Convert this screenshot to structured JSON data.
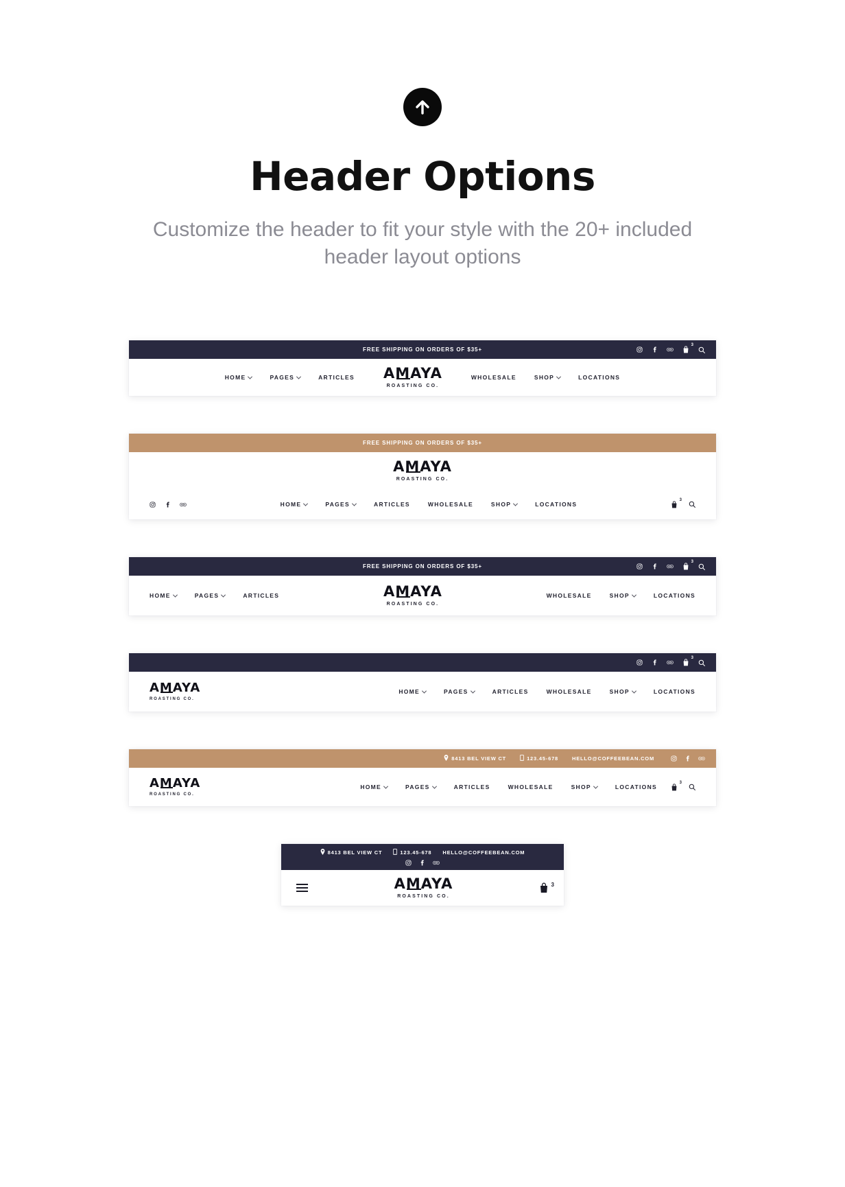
{
  "intro": {
    "icon": "arrow-up-circle-icon",
    "title": "Header Options",
    "subtitle": "Customize the header to fit your style with the 20+ included header layout options"
  },
  "brand": {
    "name": "AMAYA",
    "tagline": "ROASTING CO."
  },
  "colors": {
    "dark": "#292940",
    "tan": "#bf936c",
    "text": "#22222f",
    "muted": "#8b8b93"
  },
  "announcement": "FREE SHIPPING ON ORDERS OF $35+",
  "contact": {
    "address": "8413 BEL VIEW CT",
    "phone": "123.45-678",
    "email": "HELLO@COFFEEBEAN.COM"
  },
  "cart": {
    "count": "3"
  },
  "socials": [
    "instagram-icon",
    "facebook-icon",
    "tripadvisor-icon"
  ],
  "nav": {
    "home": "HOME",
    "pages": "PAGES",
    "articles": "ARTICLES",
    "wholesale": "WHOLESALE",
    "shop": "SHOP",
    "locations": "LOCATIONS"
  },
  "headers": [
    {
      "id": "header-1",
      "variant": "dark-topbar-centered-logo",
      "topbar_color": "#292940",
      "announcement": "FREE SHIPPING ON ORDERS OF $35+",
      "left_nav": [
        "HOME",
        "PAGES",
        "ARTICLES"
      ],
      "right_nav": [
        "WHOLESALE",
        "SHOP",
        "LOCATIONS"
      ]
    },
    {
      "id": "header-2",
      "variant": "tan-topbar-stacked-logo",
      "topbar_color": "#bf936c",
      "announcement": "FREE SHIPPING ON ORDERS OF $35+",
      "nav": [
        "HOME",
        "PAGES",
        "ARTICLES",
        "WHOLESALE",
        "SHOP",
        "LOCATIONS"
      ]
    },
    {
      "id": "header-3",
      "variant": "dark-topbar-split-nav",
      "topbar_color": "#292940",
      "announcement": "FREE SHIPPING ON ORDERS OF $35+",
      "left_nav": [
        "HOME",
        "PAGES",
        "ARTICLES"
      ],
      "right_nav": [
        "WHOLESALE",
        "SHOP",
        "LOCATIONS"
      ]
    },
    {
      "id": "header-4",
      "variant": "dark-topbar-left-logo",
      "topbar_color": "#292940",
      "announcement": "",
      "nav": [
        "HOME",
        "PAGES",
        "ARTICLES",
        "WHOLESALE",
        "SHOP",
        "LOCATIONS"
      ]
    },
    {
      "id": "header-5",
      "variant": "tan-contact-bar-left-logo",
      "topbar_color": "#bf936c",
      "nav": [
        "HOME",
        "PAGES",
        "ARTICLES",
        "WHOLESALE",
        "SHOP",
        "LOCATIONS"
      ]
    },
    {
      "id": "header-6",
      "variant": "mobile-dark-contact-bar",
      "topbar_color": "#292940"
    }
  ]
}
